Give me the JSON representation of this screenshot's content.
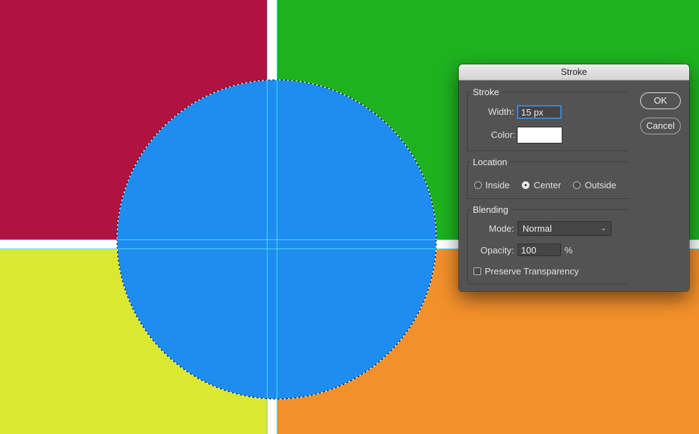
{
  "canvas": {
    "colors": {
      "top_left": "#B01241",
      "top_right": "#1FB220",
      "bottom_left": "#DAE831",
      "bottom_right": "#F2902B",
      "circle": "#1F8CF0",
      "gap": "#FFFFFF",
      "guide": "#40E0FF"
    }
  },
  "dialog": {
    "title": "Stroke",
    "stroke_group": {
      "legend": "Stroke",
      "width_label": "Width:",
      "width_value": "15 px",
      "color_label": "Color:",
      "color_value": "#FFFFFF"
    },
    "location_group": {
      "legend": "Location",
      "options": [
        "Inside",
        "Center",
        "Outside"
      ],
      "selected": "Center"
    },
    "blending_group": {
      "legend": "Blending",
      "mode_label": "Mode:",
      "mode_value": "Normal",
      "opacity_label": "Opacity:",
      "opacity_value": "100",
      "opacity_unit": "%",
      "preserve_label": "Preserve Transparency",
      "preserve_checked": false
    },
    "buttons": {
      "ok": "OK",
      "cancel": "Cancel"
    }
  }
}
